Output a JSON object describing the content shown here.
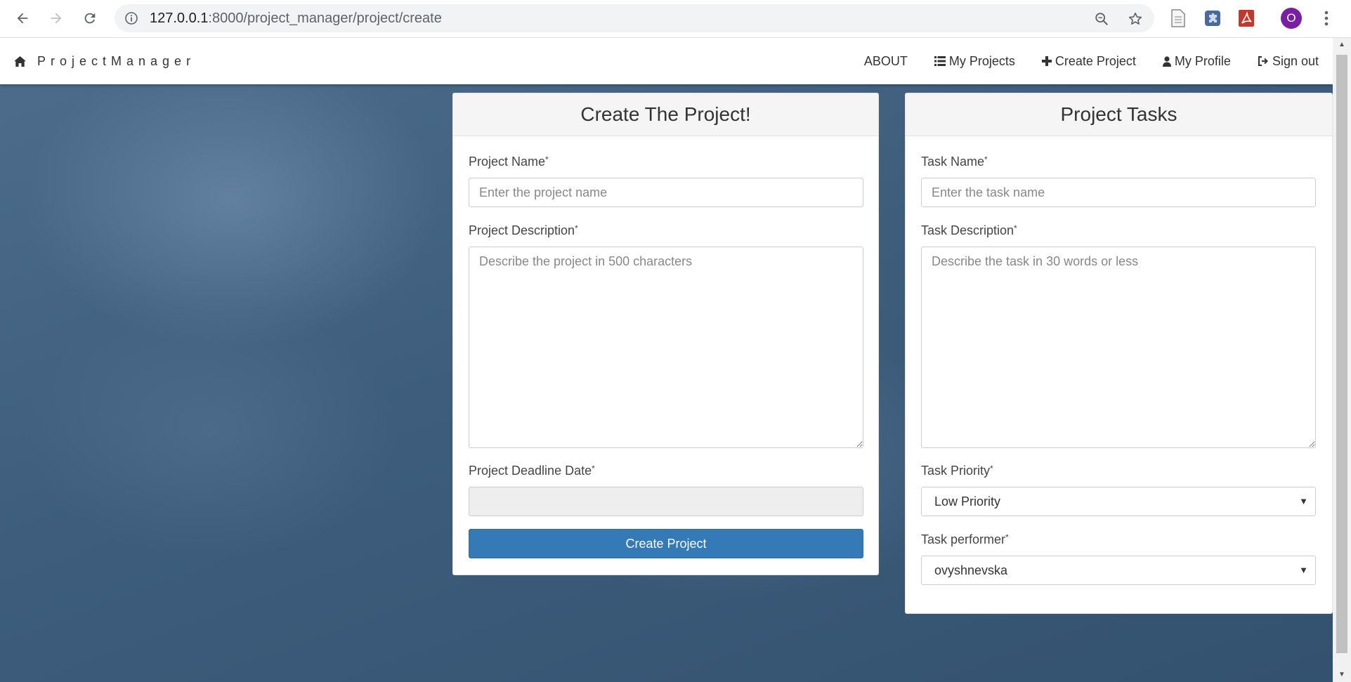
{
  "browser": {
    "url_host": "127.0.0.1",
    "url_rest": ":8000/project_manager/project/create",
    "profile_initial": "O"
  },
  "navbar": {
    "brand": "ProjectManager",
    "items": [
      {
        "label": "ABOUT",
        "icon": ""
      },
      {
        "label": "My Projects",
        "icon": "list-icon"
      },
      {
        "label": "Create Project",
        "icon": "plus-icon"
      },
      {
        "label": "My Profile",
        "icon": "user-icon"
      },
      {
        "label": "Sign out",
        "icon": "sign-out-icon"
      }
    ]
  },
  "project_form": {
    "title": "Create The Project!",
    "name_label": "Project Name",
    "name_placeholder": "Enter the project name",
    "description_label": "Project Description",
    "description_placeholder": "Describe the project in 500 characters",
    "deadline_label": "Project Deadline Date",
    "deadline_value": "",
    "submit_label": "Create Project",
    "required_mark": "*"
  },
  "task_form": {
    "title": "Project Tasks",
    "name_label": "Task Name",
    "name_placeholder": "Enter the task name",
    "description_label": "Task Description",
    "description_placeholder": "Describe the task in 30 words or less",
    "priority_label": "Task Priority",
    "priority_value": "Low Priority",
    "performer_label": "Task performer",
    "performer_value": "ovyshnevska",
    "required_mark": "*"
  },
  "colors": {
    "primary": "#337ab7",
    "avatar": "#7b1fa2",
    "background": "#3e5d7d"
  }
}
